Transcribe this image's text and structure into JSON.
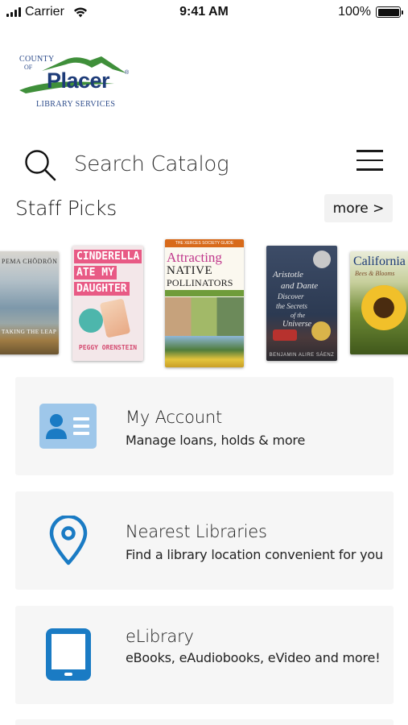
{
  "status_bar": {
    "carrier": "Carrier",
    "time": "9:41 AM",
    "battery": "100%"
  },
  "logo": {
    "county": "COUNTY",
    "of": "OF",
    "name": "Placer",
    "registered": "®",
    "subtitle": "LIBRARY SERVICES"
  },
  "search": {
    "placeholder": "Search Catalog"
  },
  "staff_picks": {
    "title": "Staff Picks",
    "more_label": "more >",
    "books": [
      {
        "author": "PEMA CHÖDRÖN",
        "title": "TAKING THE LEAP"
      },
      {
        "line1": "CINDERELLA",
        "line2": "ATE MY",
        "line3": "DAUGHTER",
        "author": "PEGGY ORENSTEIN"
      },
      {
        "series": "THE XERCES SOCIETY GUIDE",
        "line1": "Attracting",
        "line2": "NATIVE",
        "line3": "POLLINATORS"
      },
      {
        "line1": "Aristotle",
        "line2": "and Dante",
        "line3": "Discover",
        "line4": "the Secrets",
        "line5": "of the",
        "line6": "Universe",
        "author": "BENJAMIN ALIRE SÁENZ"
      },
      {
        "line1": "California",
        "line2": "Bees & Blooms"
      }
    ]
  },
  "menu": {
    "items": [
      {
        "title": "My Account",
        "description": "Manage loans, holds & more"
      },
      {
        "title": "Nearest Libraries",
        "description": "Find a library location convenient for you"
      },
      {
        "title": "eLibrary",
        "description": "eBooks, eAudiobooks, eVideo and more!"
      }
    ]
  },
  "colors": {
    "accent_blue": "#1a7bc4",
    "light_blue": "#9ec7ea",
    "logo_navy": "#1d3b78",
    "logo_green": "#3f8f3a",
    "card_bg": "#f6f6f6"
  }
}
